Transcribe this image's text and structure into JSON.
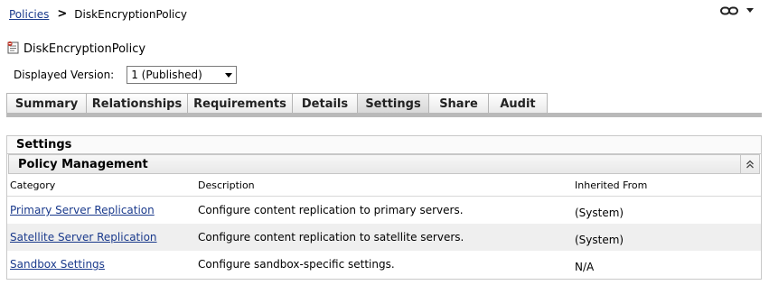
{
  "breadcrumb": {
    "root": "Policies",
    "current": "DiskEncryptionPolicy"
  },
  "header": {
    "title": "DiskEncryptionPolicy",
    "version_label": "Displayed Version:",
    "version_value": "1 (Published)"
  },
  "tabs": [
    {
      "label": "Summary"
    },
    {
      "label": "Relationships"
    },
    {
      "label": "Requirements"
    },
    {
      "label": "Details"
    },
    {
      "label": "Settings"
    },
    {
      "label": "Share"
    },
    {
      "label": "Audit"
    }
  ],
  "active_tab": "Settings",
  "panel": {
    "title": "Settings",
    "section": "Policy Management",
    "columns": {
      "category": "Category",
      "description": "Description",
      "inherited": "Inherited From"
    },
    "rows": [
      {
        "category": "Primary Server Replication",
        "description": "Configure content replication to primary servers.",
        "inherited": "(System)"
      },
      {
        "category": "Satellite Server Replication",
        "description": "Configure content replication to satellite servers.",
        "inherited": "(System)"
      },
      {
        "category": "Sandbox Settings",
        "description": "Configure sandbox-specific settings.",
        "inherited": "N/A"
      }
    ]
  },
  "colors": {
    "link": "#1a3a8c",
    "tab_bar": "#b9b9b9",
    "alt_row": "#efefef"
  }
}
